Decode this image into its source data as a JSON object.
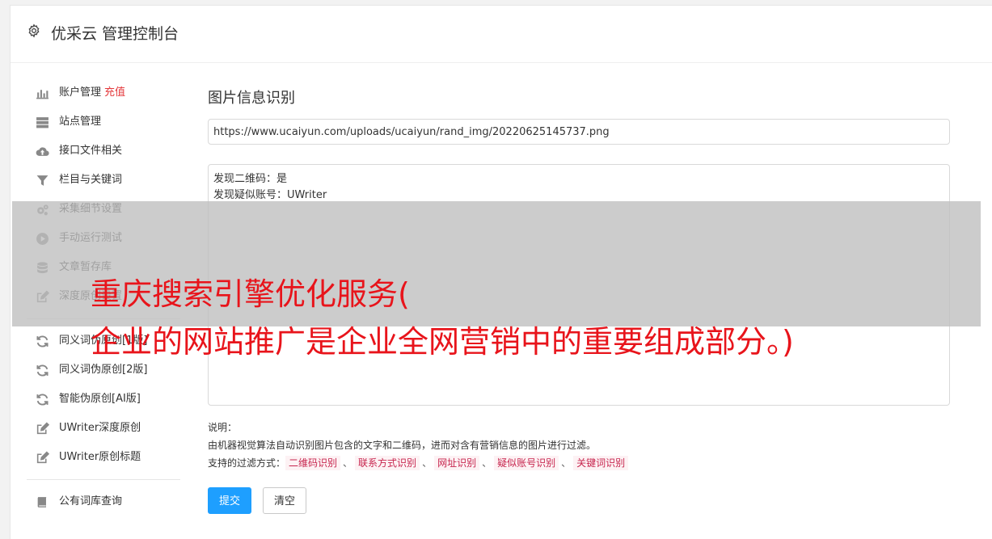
{
  "header": {
    "title": "优采云 管理控制台",
    "icon": "gear-icon"
  },
  "sidebar": {
    "group1": [
      {
        "label": "账户管理",
        "badge": "充值",
        "icon": "bar-chart-icon"
      },
      {
        "label": "站点管理",
        "icon": "server-icon"
      },
      {
        "label": "接口文件相关",
        "icon": "cloud-upload-icon"
      },
      {
        "label": "栏目与关键词",
        "icon": "filter-icon"
      },
      {
        "label": "采集细节设置",
        "icon": "gears-icon"
      },
      {
        "label": "手动运行测试",
        "icon": "play-circle-icon"
      },
      {
        "label": "文章暂存库",
        "icon": "database-icon"
      },
      {
        "label": "深度原创设置",
        "icon": "edit-icon"
      }
    ],
    "group2": [
      {
        "label": "同义词伪原创[1版]",
        "icon": "refresh-icon"
      },
      {
        "label": "同义词伪原创[2版]",
        "icon": "refresh-icon"
      },
      {
        "label": "智能伪原创[AI版]",
        "icon": "refresh-icon"
      },
      {
        "label": "UWriter深度原创",
        "icon": "edit-icon"
      },
      {
        "label": "UWriter原创标题",
        "icon": "edit-icon"
      }
    ],
    "group3": [
      {
        "label": "公有词库查询",
        "icon": "book-icon"
      }
    ]
  },
  "main": {
    "heading": "图片信息识别",
    "url_value": "https://www.ucaiyun.com/uploads/ucaiyun/rand_img/20220625145737.png",
    "result_lines": [
      "发现二维码：是",
      "发现疑似账号：UWriter"
    ],
    "notes_title": "说明：",
    "notes_desc": "由机器视觉算法自动识别图片包含的文字和二维码，进而对含有营销信息的图片进行过滤。",
    "filter_prefix": "支持的过滤方式：",
    "filter_tags": [
      "二维码识别",
      "联系方式识别",
      "网址识别",
      "疑似账号识别",
      "关键词识别"
    ],
    "filter_sep": "、",
    "submit_label": "提交",
    "clear_label": "清空"
  },
  "overlay": {
    "line1": "重庆搜索引擎优化服务(",
    "line2": "企业的网站推广是企业全网营销中的重要组成部分。)",
    "text_color": "#e8141b"
  },
  "colors": {
    "primary": "#1e9fff",
    "badge": "#e4393c",
    "tag_text": "#c7254e",
    "tag_bg": "#fdf2f4"
  }
}
